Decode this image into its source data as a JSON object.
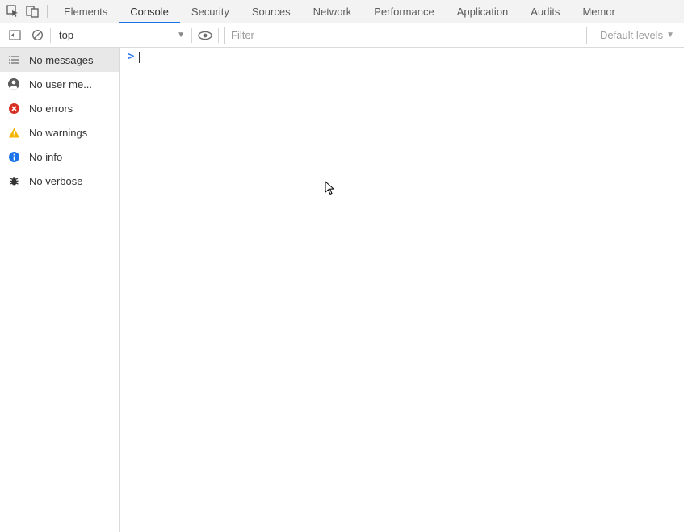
{
  "tabs": {
    "items": [
      {
        "label": "Elements",
        "active": false
      },
      {
        "label": "Console",
        "active": true
      },
      {
        "label": "Security",
        "active": false
      },
      {
        "label": "Sources",
        "active": false
      },
      {
        "label": "Network",
        "active": false
      },
      {
        "label": "Performance",
        "active": false
      },
      {
        "label": "Application",
        "active": false
      },
      {
        "label": "Audits",
        "active": false
      },
      {
        "label": "Memor",
        "active": false
      }
    ]
  },
  "subtoolbar": {
    "context": "top",
    "filter_placeholder": "Filter",
    "levels_label": "Default levels"
  },
  "sidebar": {
    "items": [
      {
        "icon": "list",
        "label": "No messages",
        "active": true
      },
      {
        "icon": "user",
        "label": "No user me...",
        "active": false
      },
      {
        "icon": "error",
        "label": "No errors",
        "active": false
      },
      {
        "icon": "warning",
        "label": "No warnings",
        "active": false
      },
      {
        "icon": "info",
        "label": "No info",
        "active": false
      },
      {
        "icon": "bug",
        "label": "No verbose",
        "active": false
      }
    ]
  },
  "console": {
    "prompt": ">"
  }
}
